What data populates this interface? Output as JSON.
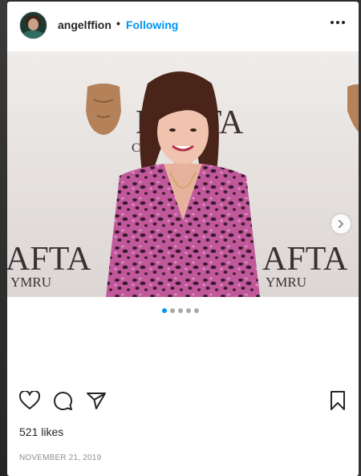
{
  "post": {
    "username": "angelffion",
    "separator": "•",
    "follow_status": "Following",
    "likes": "521 likes",
    "date": "NOVEMBER 21, 2019"
  },
  "photo": {
    "backdrop_text_1": "BAFTA",
    "backdrop_text_2": "CYMRU",
    "carousel_total": 5,
    "carousel_active": 1
  },
  "icons": {
    "more": "more-options-icon",
    "like": "heart-icon",
    "comment": "comment-icon",
    "share": "share-icon",
    "save": "bookmark-icon",
    "next": "chevron-right-icon"
  },
  "colors": {
    "accent": "#0095f6",
    "text": "#262626",
    "muted": "#8e8e8e"
  }
}
